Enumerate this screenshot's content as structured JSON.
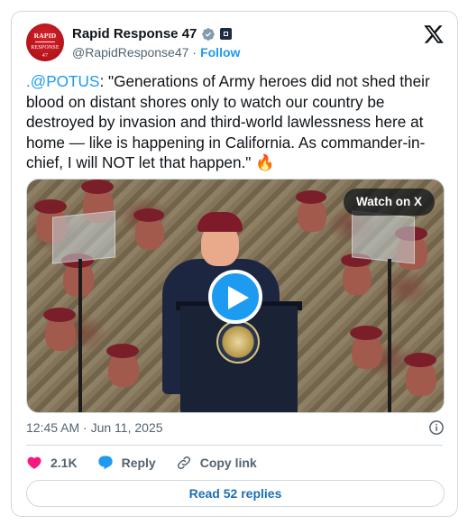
{
  "author": {
    "name": "Rapid Response 47",
    "handle": "@RapidResponse47",
    "separator": "·",
    "follow_label": "Follow",
    "avatar_logo_line1": "RAPID",
    "avatar_logo_line2": "RESPONSE",
    "avatar_logo_line3": "47"
  },
  "tweet": {
    "mention": ".@POTUS",
    "text": ": \"Generations of Army heroes did not shed their blood on distant shores only to watch our country be destroyed by invasion and third-world lawlessness here at home — like is happening in California. As commander-in-chief, I will NOT let that happen.\" ",
    "emoji": "🔥"
  },
  "media": {
    "watch_label": "Watch on X",
    "play_icon": "play-icon"
  },
  "meta": {
    "timestamp": "12:45 AM · Jun 11, 2025"
  },
  "actions": {
    "like_count": "2.1K",
    "reply_label": "Reply",
    "copy_label": "Copy link"
  },
  "read_replies_label": "Read 52 replies",
  "colors": {
    "accent": "#1d9bf0",
    "like": "#f91880",
    "avatar_red": "#c8161d"
  }
}
